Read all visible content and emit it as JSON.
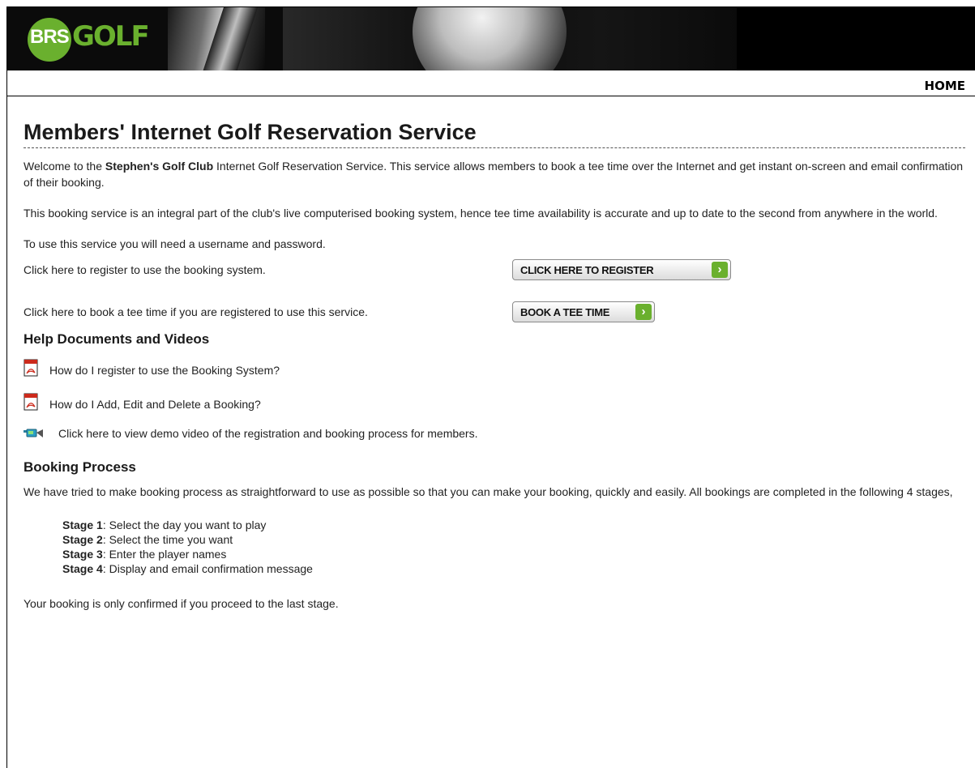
{
  "header": {
    "logo_brs": "BRS",
    "logo_golf": "GOLF",
    "home_link": "HOME"
  },
  "main": {
    "title": "Members' Internet Golf Reservation Service",
    "welcome_prefix": "Welcome to the ",
    "club_name": "Stephen's Golf Club",
    "welcome_suffix": " Internet Golf Reservation Service. This service allows members to book a tee time over the Internet and get instant on-screen and email confirmation of their booking.",
    "integral_text": "This booking service is an integral part of the club's live computerised booking system, hence tee time availability is accurate and up to date to the second from anywhere in the world.",
    "need_credentials": "To use this service you will need a username and password.",
    "register_text": "Click here to register to use the booking system.",
    "register_button": "CLICK HERE TO REGISTER",
    "book_text": "Click here to book a tee time if you are registered to use this service.",
    "book_button": "BOOK A TEE TIME",
    "arrow_glyph": "›"
  },
  "help": {
    "heading": "Help Documents and Videos",
    "items": [
      {
        "icon": "pdf-icon",
        "label": "How do I register to use the Booking System?"
      },
      {
        "icon": "pdf-icon",
        "label": "How do I Add, Edit and Delete a Booking?"
      },
      {
        "icon": "video-camera-icon",
        "label": "Click here to view demo video of the registration and booking process for members."
      }
    ]
  },
  "booking": {
    "heading": "Booking Process",
    "intro": "We have tried to make booking process as straightforward to use as possible so that you can make your booking, quickly and easily. All bookings are completed in the following 4 stages,",
    "stages": [
      {
        "label": "Stage 1",
        "text": ": Select the day you want to play"
      },
      {
        "label": "Stage 2",
        "text": ": Select the time you want"
      },
      {
        "label": "Stage 3",
        "text": ": Enter the player names"
      },
      {
        "label": "Stage 4",
        "text": ": Display and email confirmation message"
      }
    ],
    "footer": "Your booking is only confirmed if you proceed to the last stage."
  },
  "colors": {
    "brand_green": "#6ab02e",
    "banner_bg": "#0b0b0b"
  }
}
